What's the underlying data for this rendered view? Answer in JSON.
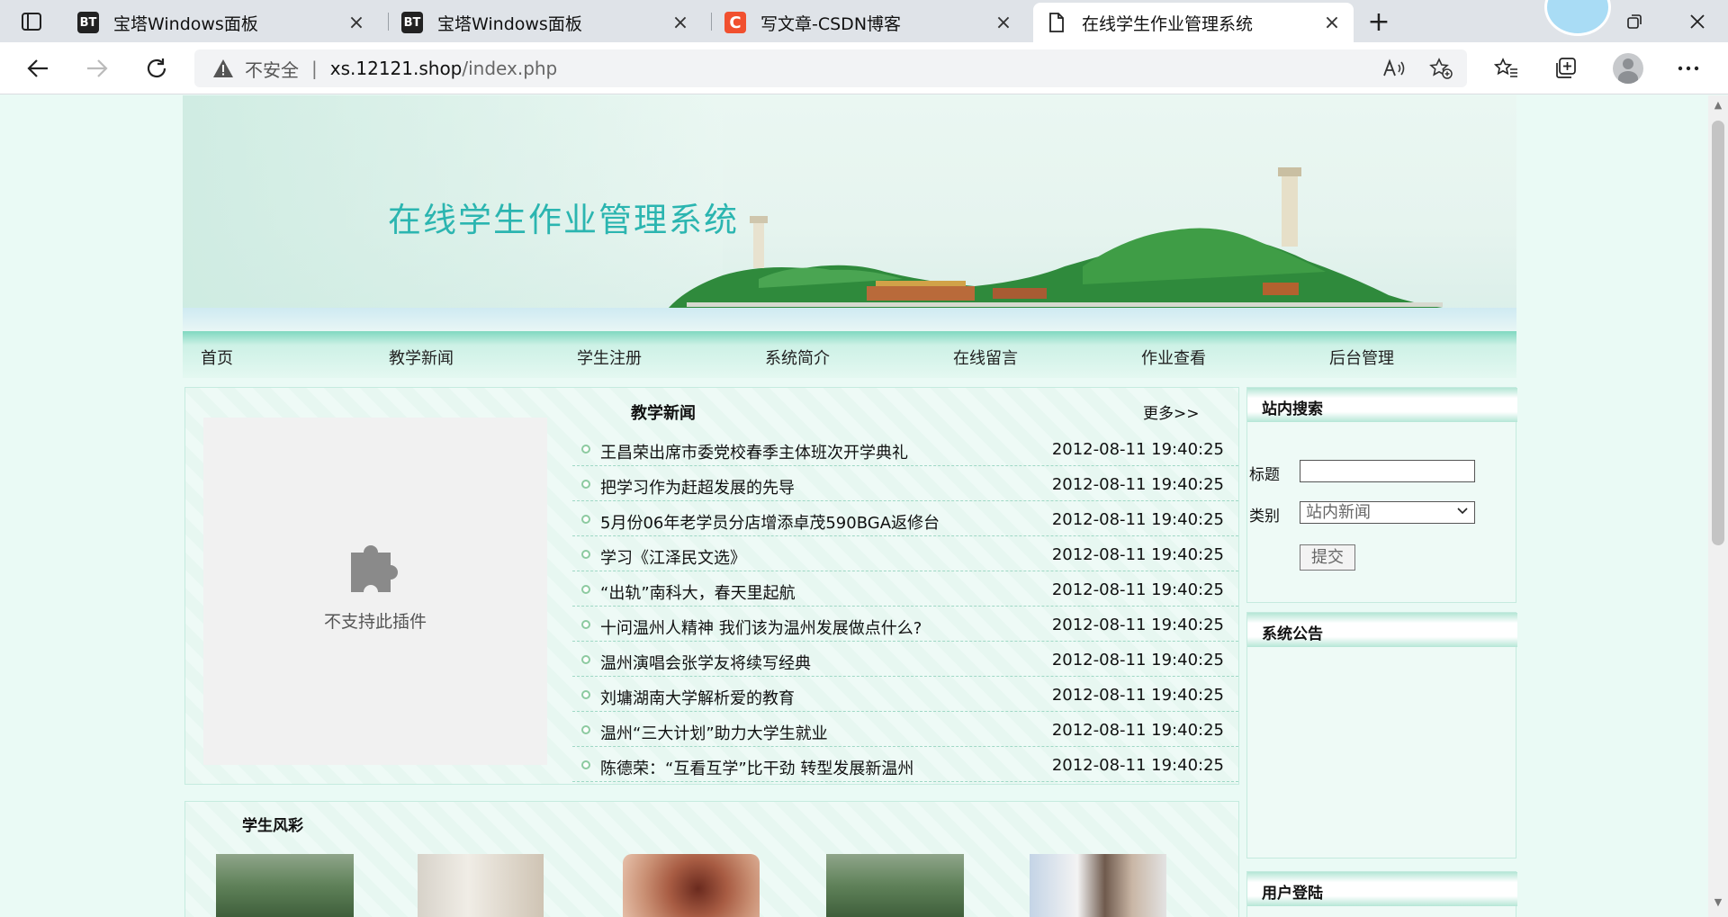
{
  "browser": {
    "tabs": [
      {
        "icon": "BT",
        "title": "宝塔Windows面板"
      },
      {
        "icon": "BT",
        "title": "宝塔Windows面板"
      },
      {
        "icon": "C",
        "title": "写文章-CSDN博客"
      },
      {
        "icon": "",
        "title": "在线学生作业管理系统"
      }
    ],
    "new_tab": "+",
    "security_label": "不安全",
    "url_host": "xs.12121.shop",
    "url_path": "/index.php"
  },
  "site": {
    "banner_title": "在线学生作业管理系统",
    "nav": [
      "首页",
      "教学新闻",
      "学生注册",
      "系统简介",
      "在线留言",
      "作业查看",
      "后台管理"
    ],
    "plugin_message": "不支持此插件",
    "news": {
      "title": "教学新闻",
      "more": "更多>>",
      "items": [
        {
          "title": "王昌荣出席市委党校春季主体班次开学典礼",
          "date": "2012-08-11 19:40:25"
        },
        {
          "title": "把学习作为赶超发展的先导",
          "date": "2012-08-11 19:40:25"
        },
        {
          "title": "5月份06年老学员分店增添卓茂590BGA返修台",
          "date": "2012-08-11 19:40:25"
        },
        {
          "title": "学习《江泽民文选》",
          "date": "2012-08-11 19:40:25"
        },
        {
          "title": "“出轨”南科大，春天里起航",
          "date": "2012-08-11 19:40:25"
        },
        {
          "title": "十问温州人精神 我们该为温州发展做点什么?",
          "date": "2012-08-11 19:40:25"
        },
        {
          "title": "温州演唱会张学友将续写经典",
          "date": "2012-08-11 19:40:25"
        },
        {
          "title": "刘墉湖南大学解析爱的教育",
          "date": "2012-08-11 19:40:25"
        },
        {
          "title": "温州“三大计划”助力大学生就业",
          "date": "2012-08-11 19:40:25"
        },
        {
          "title": "陈德荣：“互看互学”比干劲 转型发展新温州",
          "date": "2012-08-11 19:40:25"
        }
      ]
    },
    "students": {
      "title": "学生风彩"
    },
    "search": {
      "title": "站内搜索",
      "title_label": "标题",
      "title_value": "",
      "category_label": "类别",
      "category_value": "站内新闻",
      "submit": "提交"
    },
    "notice": {
      "title": "系统公告"
    },
    "login": {
      "title": "用户登陆"
    }
  },
  "colors": {
    "accent": "#2bb5b0",
    "nav_bar": "#7fd8c0",
    "page_bg": "#eafaf5"
  }
}
